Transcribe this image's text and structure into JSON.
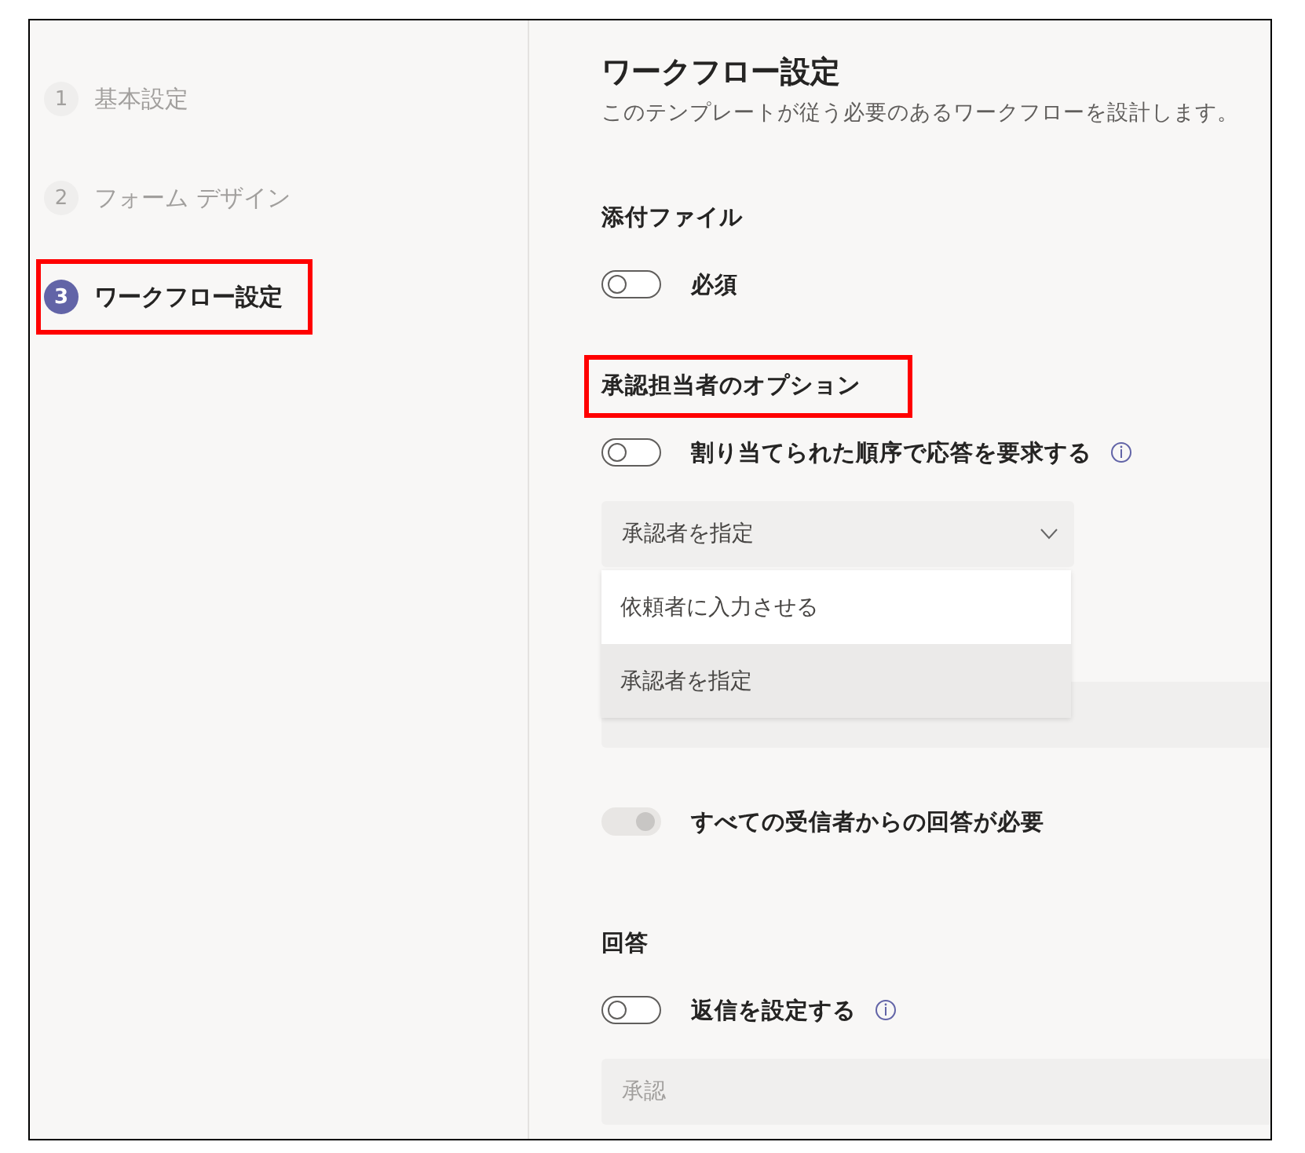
{
  "sidebar": {
    "steps": [
      {
        "number": "1",
        "label": "基本設定",
        "selected": false,
        "highlighted": false
      },
      {
        "number": "2",
        "label": "フォーム デザイン",
        "selected": false,
        "highlighted": false
      },
      {
        "number": "3",
        "label": "ワークフロー設定",
        "selected": true,
        "highlighted": true
      }
    ]
  },
  "header": {
    "title": "ワークフロー設定",
    "subtitle": "このテンプレートが従う必要のあるワークフローを設計します。"
  },
  "sections": [
    {
      "title": "添付ファイル",
      "highlighted": false,
      "items": [
        {
          "kind": "toggle",
          "label": "必須",
          "on": false,
          "disabled": false,
          "info": false
        }
      ]
    },
    {
      "title": "承認担当者のオプション",
      "highlighted": true,
      "items": [
        {
          "kind": "toggle",
          "label": "割り当てられた順序で応答を要求する",
          "on": false,
          "disabled": false,
          "info": true
        },
        {
          "kind": "dropdown",
          "value": "承認者を指定",
          "expanded": true,
          "options": [
            {
              "label": "依頼者に入力させる",
              "selected": false
            },
            {
              "label": "承認者を指定",
              "selected": true
            }
          ]
        },
        {
          "kind": "field"
        },
        {
          "kind": "toggle",
          "label": "すべての受信者からの回答が必要",
          "on": true,
          "disabled": true,
          "info": false
        }
      ]
    },
    {
      "title": "回答",
      "highlighted": false,
      "items": [
        {
          "kind": "toggle",
          "label": "返信を設定する",
          "on": false,
          "disabled": false,
          "info": true
        },
        {
          "kind": "field",
          "placeholder": "承認"
        }
      ]
    }
  ]
}
